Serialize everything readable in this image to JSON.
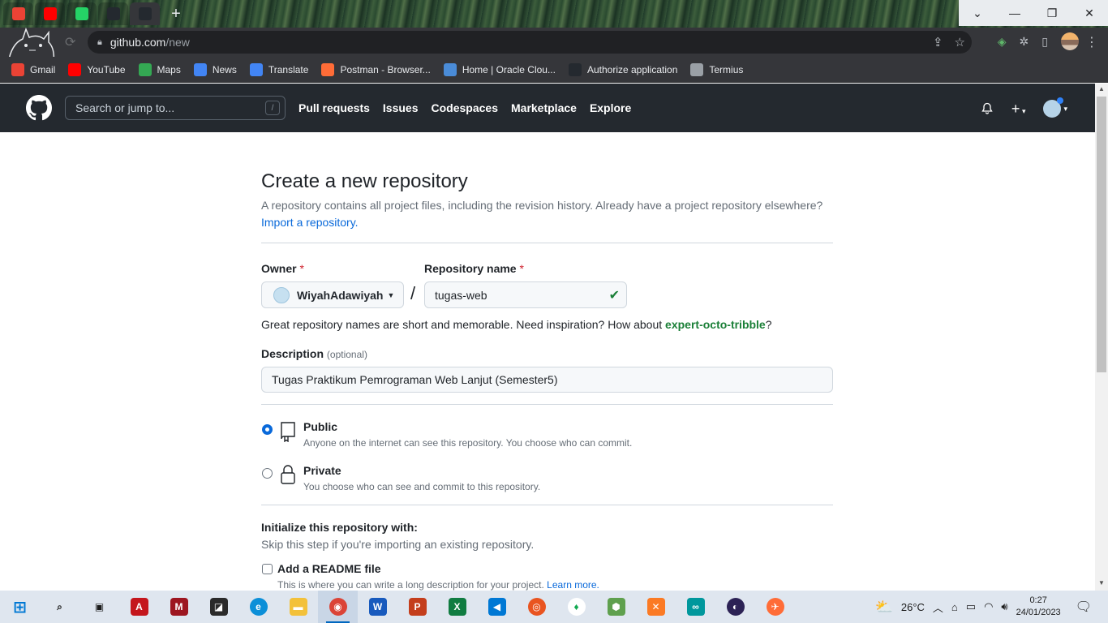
{
  "browser": {
    "tabs": [
      {
        "icon": "gmail-icon",
        "color": "#ea4335"
      },
      {
        "icon": "youtube-icon",
        "color": "#ff0000"
      },
      {
        "icon": "whatsapp-icon",
        "color": "#25d366"
      },
      {
        "icon": "github-icon",
        "color": "#24292f"
      },
      {
        "icon": "github-icon",
        "color": "#24292f"
      }
    ],
    "url_host": "github.com",
    "url_path": "/new",
    "bookmarks": [
      {
        "label": "Gmail",
        "icon": "gmail-icon",
        "color": "#ea4335"
      },
      {
        "label": "YouTube",
        "icon": "youtube-icon",
        "color": "#ff0000"
      },
      {
        "label": "Maps",
        "icon": "maps-icon",
        "color": "#34a853"
      },
      {
        "label": "News",
        "icon": "news-icon",
        "color": "#4285f4"
      },
      {
        "label": "Translate",
        "icon": "translate-icon",
        "color": "#4285f4"
      },
      {
        "label": "Postman - Browser...",
        "icon": "postman-icon",
        "color": "#ff6c37"
      },
      {
        "label": "Home | Oracle Clou...",
        "icon": "cloud-icon",
        "color": "#4a8cd8"
      },
      {
        "label": "Authorize application",
        "icon": "github-icon",
        "color": "#24292f"
      },
      {
        "label": "Termius",
        "icon": "termius-icon",
        "color": "#9aa0a6"
      }
    ]
  },
  "github": {
    "search_placeholder": "Search or jump to...",
    "search_shortcut": "/",
    "nav": [
      "Pull requests",
      "Issues",
      "Codespaces",
      "Marketplace",
      "Explore"
    ]
  },
  "form": {
    "title": "Create a new repository",
    "description": "A repository contains all project files, including the revision history. Already have a project repository elsewhere?",
    "import_link": "Import a repository.",
    "owner_label": "Owner",
    "owner_value": "WiyahAdawiyah",
    "repo_label": "Repository name",
    "required_mark": "*",
    "separator": "/",
    "repo_value": "tugas-web",
    "hint_prefix": "Great repository names are short and memorable. Need inspiration? How about ",
    "hint_suggestion": "expert-octo-tribble",
    "hint_suffix": "?",
    "description_label": "Description",
    "optional_label": "(optional)",
    "description_value": "Tugas Praktikum Pemrograman Web Lanjut (Semester5)",
    "visibility": [
      {
        "title": "Public",
        "desc": "Anyone on the internet can see this repository. You choose who can commit.",
        "selected": true
      },
      {
        "title": "Private",
        "desc": "You choose who can see and commit to this repository.",
        "selected": false
      }
    ],
    "init_title": "Initialize this repository with:",
    "init_desc": "Skip this step if you're importing an existing repository.",
    "readme_label": "Add a README file",
    "readme_desc": "This is where you can write a long description for your project.",
    "readme_link": "Learn more."
  },
  "taskbar": {
    "apps": [
      {
        "name": "start-icon",
        "color": "#0078d4",
        "glyph": "⊞"
      },
      {
        "name": "search-icon",
        "color": "transparent",
        "glyph": "⌕"
      },
      {
        "name": "task-view-icon",
        "color": "transparent",
        "glyph": "▣"
      },
      {
        "name": "acrobat-icon",
        "color": "#c4161c",
        "glyph": "A"
      },
      {
        "name": "mendeley-icon",
        "color": "#9d1620",
        "glyph": "M"
      },
      {
        "name": "sticky-notes-icon",
        "color": "#2b2b2b",
        "glyph": "◪"
      },
      {
        "name": "edge-icon",
        "color": "#0c8fd8",
        "glyph": "e"
      },
      {
        "name": "file-explorer-icon",
        "color": "#f3c13a",
        "glyph": "▬"
      },
      {
        "name": "chrome-icon",
        "color": "#db4437",
        "glyph": "◉"
      },
      {
        "name": "word-icon",
        "color": "#185abd",
        "glyph": "W"
      },
      {
        "name": "powerpoint-icon",
        "color": "#c43e1c",
        "glyph": "P"
      },
      {
        "name": "excel-icon",
        "color": "#107c41",
        "glyph": "X"
      },
      {
        "name": "vscode-icon",
        "color": "#0078d4",
        "glyph": "◀"
      },
      {
        "name": "ubuntu-icon",
        "color": "#e95420",
        "glyph": "◎"
      },
      {
        "name": "mongodb-icon",
        "color": "#ffffff",
        "glyph": "♦"
      },
      {
        "name": "nodejs-icon",
        "color": "#5fa04e",
        "glyph": "⬢"
      },
      {
        "name": "xampp-icon",
        "color": "#fb7a24",
        "glyph": "✕"
      },
      {
        "name": "arduino-icon",
        "color": "#00979c",
        "glyph": "∞"
      },
      {
        "name": "eclipse-icon",
        "color": "#2c2255",
        "glyph": "◐"
      },
      {
        "name": "postman-icon",
        "color": "#ff6c37",
        "glyph": "✈"
      }
    ],
    "weather": "26°C",
    "time": "0:27",
    "date": "24/01/2023"
  }
}
